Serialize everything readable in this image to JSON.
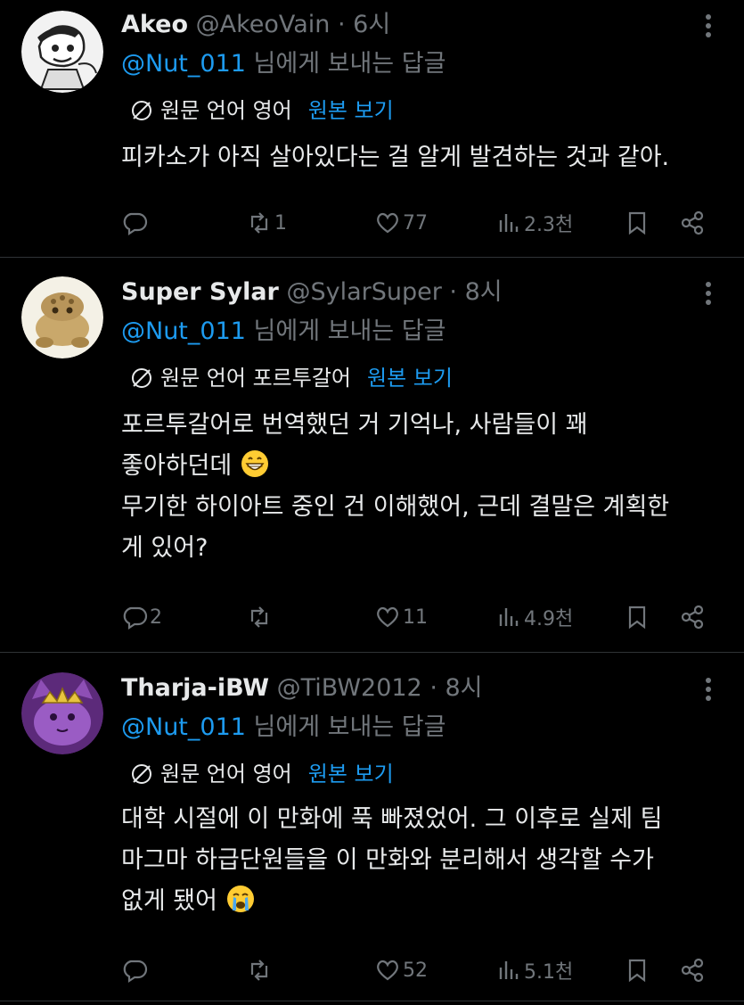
{
  "colors": {
    "accent": "#1d9bf0",
    "muted": "#71767b",
    "text": "#e7e9ea",
    "background": "#000000"
  },
  "tweets": [
    {
      "name": "Akeo",
      "handle": "@AkeoVain",
      "time": "· 6시",
      "reply_mention": "@Nut_011",
      "reply_suffix": " 님에게 보내는 답글",
      "translate_label": "원문 언어 영어",
      "show_original": "원본 보기",
      "body": [
        "피카소가 아직 살아있다는 걸 알게 발견하는 것과 같아."
      ],
      "replies": "",
      "retweets": "1",
      "likes": "77",
      "views": "2.3천"
    },
    {
      "name": "Super Sylar",
      "handle": "@SylarSuper",
      "time": "· 8시",
      "reply_mention": "@Nut_011",
      "reply_suffix": " 님에게 보내는 답글",
      "translate_label": "원문 언어 포르투갈어",
      "show_original": "원본 보기",
      "body": [
        "포르투갈어로 번역했던 거 기억나, 사람들이 꽤",
        "좋아하던데",
        "무기한 하이아트 중인 건 이해했어, 근데 결말은 계획한",
        "게 있어?"
      ],
      "replies": "2",
      "retweets": "",
      "likes": "11",
      "views": "4.9천"
    },
    {
      "name": "Tharja-iBW",
      "handle": "@TiBW2012",
      "time": "· 8시",
      "reply_mention": "@Nut_011",
      "reply_suffix": " 님에게 보내는 답글",
      "translate_label": "원문 언어 영어",
      "show_original": "원본 보기",
      "body": [
        "대학 시절에 이 만화에 푹 빠졌었어. 그 이후로 실제 팀",
        "마그마 하급단원들을 이 만화와 분리해서 생각할 수가",
        "없게 됐어"
      ],
      "replies": "",
      "retweets": "",
      "likes": "52",
      "views": "5.1천"
    }
  ],
  "icons": [
    "globe-slash-icon",
    "more-icon",
    "reply-icon",
    "retweet-icon",
    "like-icon",
    "views-icon",
    "bookmark-icon",
    "share-icon",
    "grin-emoji-icon",
    "crying-emoji-icon"
  ]
}
